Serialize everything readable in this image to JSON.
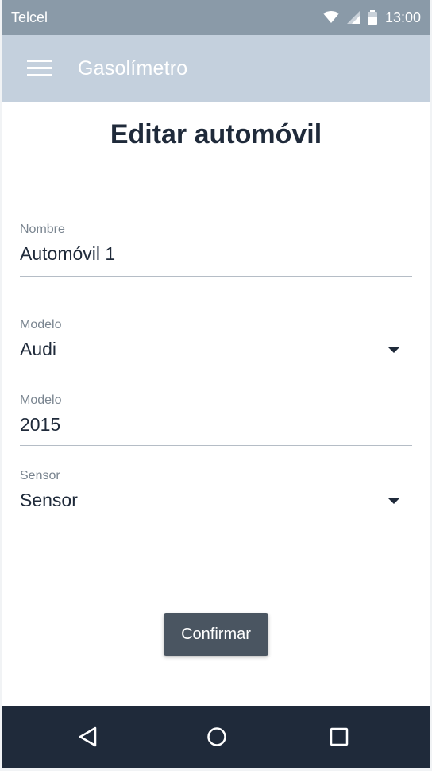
{
  "status_bar": {
    "carrier": "Telcel",
    "time": "13:00"
  },
  "app_bar": {
    "title": "Gasolímetro"
  },
  "page": {
    "title": "Editar automóvil"
  },
  "form": {
    "fields": [
      {
        "label": "Nombre",
        "value": "Automóvil 1",
        "type": "text"
      },
      {
        "label": "Modelo",
        "value": "Audi",
        "type": "select"
      },
      {
        "label": "Modelo",
        "value": "2015",
        "type": "text"
      },
      {
        "label": "Sensor",
        "value": "Sensor",
        "type": "select"
      }
    ]
  },
  "actions": {
    "confirm_label": "Confirmar"
  },
  "colors": {
    "status_bar": "#8a9aa8",
    "app_bar": "#c4d0dd",
    "nav_bar": "#1f2a3a",
    "button": "#4a5561",
    "text_primary": "#1f2a3a",
    "text_label": "#7a8590"
  },
  "icons": {
    "menu": "hamburger-icon",
    "wifi": "wifi-icon",
    "signal": "signal-icon",
    "battery": "battery-icon",
    "back": "back-triangle-icon",
    "home": "home-circle-icon",
    "recents": "recents-square-icon"
  }
}
